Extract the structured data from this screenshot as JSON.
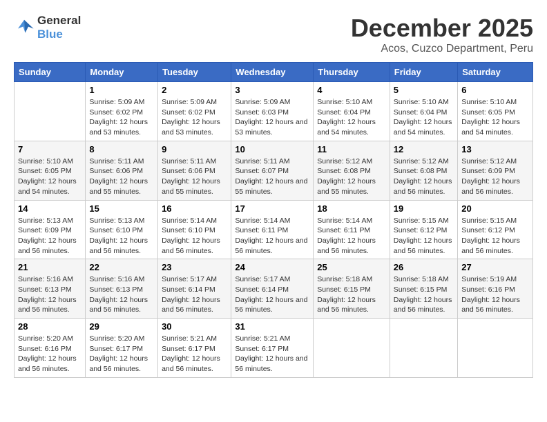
{
  "logo": {
    "line1": "General",
    "line2": "Blue"
  },
  "title": "December 2025",
  "subtitle": "Acos, Cuzco Department, Peru",
  "header_accent_color": "#3a6bc4",
  "days_of_week": [
    "Sunday",
    "Monday",
    "Tuesday",
    "Wednesday",
    "Thursday",
    "Friday",
    "Saturday"
  ],
  "weeks": [
    [
      {
        "day": "",
        "sunrise": "",
        "sunset": "",
        "daylight": ""
      },
      {
        "day": "1",
        "sunrise": "Sunrise: 5:09 AM",
        "sunset": "Sunset: 6:02 PM",
        "daylight": "Daylight: 12 hours and 53 minutes."
      },
      {
        "day": "2",
        "sunrise": "Sunrise: 5:09 AM",
        "sunset": "Sunset: 6:02 PM",
        "daylight": "Daylight: 12 hours and 53 minutes."
      },
      {
        "day": "3",
        "sunrise": "Sunrise: 5:09 AM",
        "sunset": "Sunset: 6:03 PM",
        "daylight": "Daylight: 12 hours and 53 minutes."
      },
      {
        "day": "4",
        "sunrise": "Sunrise: 5:10 AM",
        "sunset": "Sunset: 6:04 PM",
        "daylight": "Daylight: 12 hours and 54 minutes."
      },
      {
        "day": "5",
        "sunrise": "Sunrise: 5:10 AM",
        "sunset": "Sunset: 6:04 PM",
        "daylight": "Daylight: 12 hours and 54 minutes."
      },
      {
        "day": "6",
        "sunrise": "Sunrise: 5:10 AM",
        "sunset": "Sunset: 6:05 PM",
        "daylight": "Daylight: 12 hours and 54 minutes."
      }
    ],
    [
      {
        "day": "7",
        "sunrise": "Sunrise: 5:10 AM",
        "sunset": "Sunset: 6:05 PM",
        "daylight": "Daylight: 12 hours and 54 minutes."
      },
      {
        "day": "8",
        "sunrise": "Sunrise: 5:11 AM",
        "sunset": "Sunset: 6:06 PM",
        "daylight": "Daylight: 12 hours and 55 minutes."
      },
      {
        "day": "9",
        "sunrise": "Sunrise: 5:11 AM",
        "sunset": "Sunset: 6:06 PM",
        "daylight": "Daylight: 12 hours and 55 minutes."
      },
      {
        "day": "10",
        "sunrise": "Sunrise: 5:11 AM",
        "sunset": "Sunset: 6:07 PM",
        "daylight": "Daylight: 12 hours and 55 minutes."
      },
      {
        "day": "11",
        "sunrise": "Sunrise: 5:12 AM",
        "sunset": "Sunset: 6:08 PM",
        "daylight": "Daylight: 12 hours and 55 minutes."
      },
      {
        "day": "12",
        "sunrise": "Sunrise: 5:12 AM",
        "sunset": "Sunset: 6:08 PM",
        "daylight": "Daylight: 12 hours and 56 minutes."
      },
      {
        "day": "13",
        "sunrise": "Sunrise: 5:12 AM",
        "sunset": "Sunset: 6:09 PM",
        "daylight": "Daylight: 12 hours and 56 minutes."
      }
    ],
    [
      {
        "day": "14",
        "sunrise": "Sunrise: 5:13 AM",
        "sunset": "Sunset: 6:09 PM",
        "daylight": "Daylight: 12 hours and 56 minutes."
      },
      {
        "day": "15",
        "sunrise": "Sunrise: 5:13 AM",
        "sunset": "Sunset: 6:10 PM",
        "daylight": "Daylight: 12 hours and 56 minutes."
      },
      {
        "day": "16",
        "sunrise": "Sunrise: 5:14 AM",
        "sunset": "Sunset: 6:10 PM",
        "daylight": "Daylight: 12 hours and 56 minutes."
      },
      {
        "day": "17",
        "sunrise": "Sunrise: 5:14 AM",
        "sunset": "Sunset: 6:11 PM",
        "daylight": "Daylight: 12 hours and 56 minutes."
      },
      {
        "day": "18",
        "sunrise": "Sunrise: 5:14 AM",
        "sunset": "Sunset: 6:11 PM",
        "daylight": "Daylight: 12 hours and 56 minutes."
      },
      {
        "day": "19",
        "sunrise": "Sunrise: 5:15 AM",
        "sunset": "Sunset: 6:12 PM",
        "daylight": "Daylight: 12 hours and 56 minutes."
      },
      {
        "day": "20",
        "sunrise": "Sunrise: 5:15 AM",
        "sunset": "Sunset: 6:12 PM",
        "daylight": "Daylight: 12 hours and 56 minutes."
      }
    ],
    [
      {
        "day": "21",
        "sunrise": "Sunrise: 5:16 AM",
        "sunset": "Sunset: 6:13 PM",
        "daylight": "Daylight: 12 hours and 56 minutes."
      },
      {
        "day": "22",
        "sunrise": "Sunrise: 5:16 AM",
        "sunset": "Sunset: 6:13 PM",
        "daylight": "Daylight: 12 hours and 56 minutes."
      },
      {
        "day": "23",
        "sunrise": "Sunrise: 5:17 AM",
        "sunset": "Sunset: 6:14 PM",
        "daylight": "Daylight: 12 hours and 56 minutes."
      },
      {
        "day": "24",
        "sunrise": "Sunrise: 5:17 AM",
        "sunset": "Sunset: 6:14 PM",
        "daylight": "Daylight: 12 hours and 56 minutes."
      },
      {
        "day": "25",
        "sunrise": "Sunrise: 5:18 AM",
        "sunset": "Sunset: 6:15 PM",
        "daylight": "Daylight: 12 hours and 56 minutes."
      },
      {
        "day": "26",
        "sunrise": "Sunrise: 5:18 AM",
        "sunset": "Sunset: 6:15 PM",
        "daylight": "Daylight: 12 hours and 56 minutes."
      },
      {
        "day": "27",
        "sunrise": "Sunrise: 5:19 AM",
        "sunset": "Sunset: 6:16 PM",
        "daylight": "Daylight: 12 hours and 56 minutes."
      }
    ],
    [
      {
        "day": "28",
        "sunrise": "Sunrise: 5:20 AM",
        "sunset": "Sunset: 6:16 PM",
        "daylight": "Daylight: 12 hours and 56 minutes."
      },
      {
        "day": "29",
        "sunrise": "Sunrise: 5:20 AM",
        "sunset": "Sunset: 6:17 PM",
        "daylight": "Daylight: 12 hours and 56 minutes."
      },
      {
        "day": "30",
        "sunrise": "Sunrise: 5:21 AM",
        "sunset": "Sunset: 6:17 PM",
        "daylight": "Daylight: 12 hours and 56 minutes."
      },
      {
        "day": "31",
        "sunrise": "Sunrise: 5:21 AM",
        "sunset": "Sunset: 6:17 PM",
        "daylight": "Daylight: 12 hours and 56 minutes."
      },
      {
        "day": "",
        "sunrise": "",
        "sunset": "",
        "daylight": ""
      },
      {
        "day": "",
        "sunrise": "",
        "sunset": "",
        "daylight": ""
      },
      {
        "day": "",
        "sunrise": "",
        "sunset": "",
        "daylight": ""
      }
    ]
  ]
}
